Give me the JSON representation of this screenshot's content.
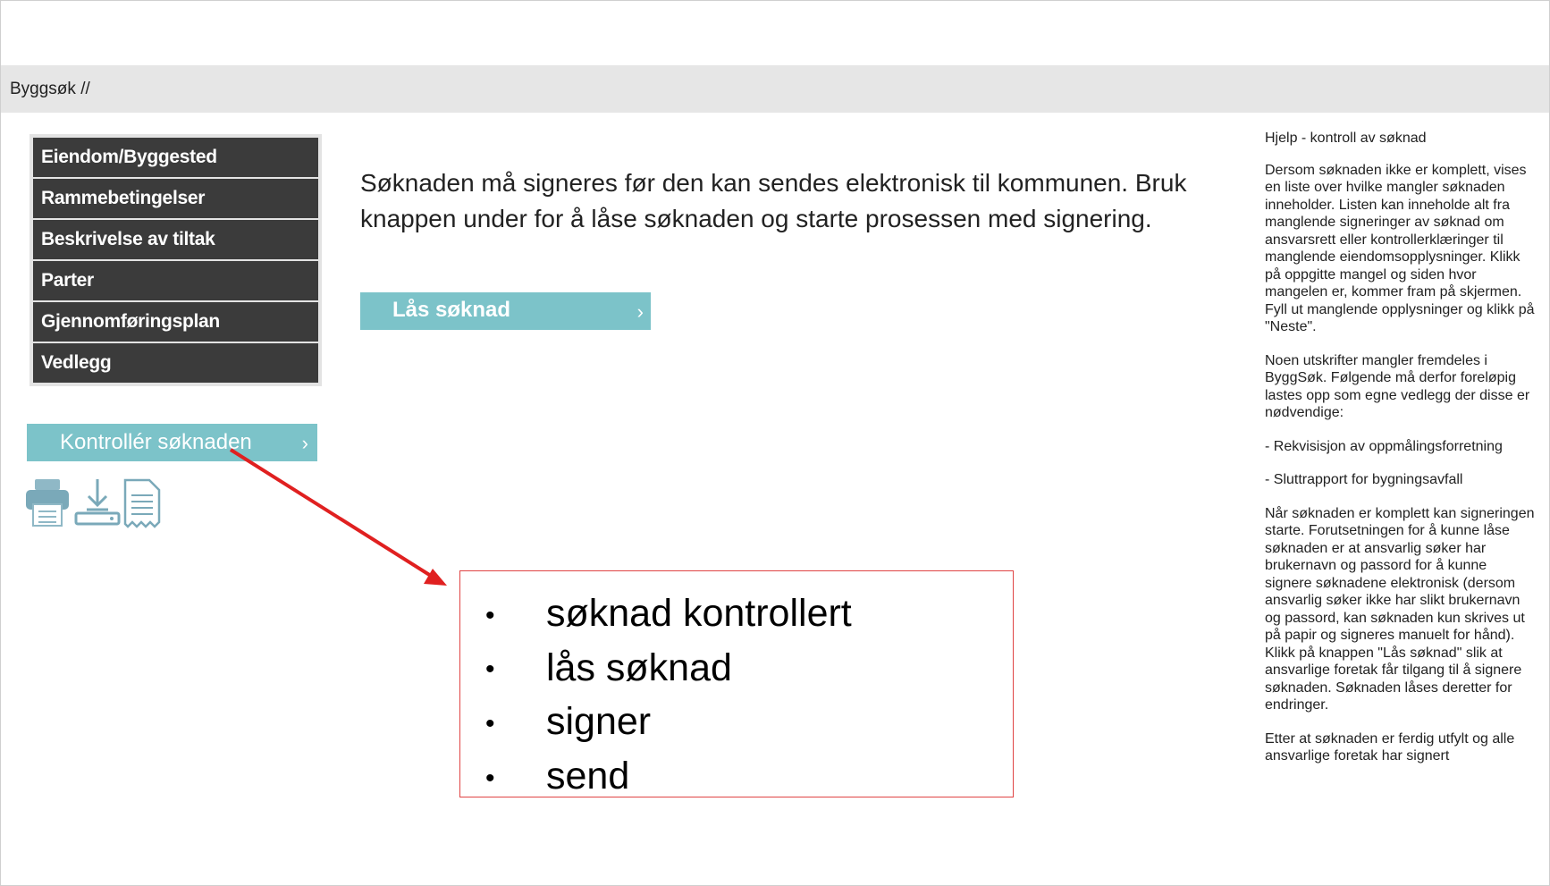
{
  "breadcrumb": "Byggsøk //",
  "nav": {
    "items": [
      {
        "label": "Eiendom/Byggested"
      },
      {
        "label": "Rammebetingelser"
      },
      {
        "label": "Beskrivelse av tiltak"
      },
      {
        "label": "Parter"
      },
      {
        "label": "Gjennomføringsplan"
      },
      {
        "label": "Vedlegg"
      }
    ]
  },
  "check_button": {
    "label": "Kontrollér søknaden",
    "chevron": "›"
  },
  "tools": {
    "icons": [
      "print-icon",
      "download-icon",
      "document-icon"
    ]
  },
  "main": {
    "message": "Søknaden må signeres før den kan sendes elektronisk til kommunen. Bruk knappen under for å låse søknaden og starte prosessen med signering.",
    "lock_button": {
      "label": "Lås søknad",
      "chevron": "›"
    }
  },
  "help": {
    "title": "Hjelp - kontroll av søknad",
    "paragraphs": [
      "Dersom søknaden ikke er komplett, vises en liste over hvilke mangler søknaden inneholder. Listen kan inneholde alt fra manglende signeringer av søknad om ansvarsrett eller kontrollerklæringer til manglende eiendomsopplysninger. Klikk på oppgitte mangel og siden hvor mangelen er, kommer fram på skjermen. Fyll ut manglende opplysninger og klikk på \"Neste\".",
      "Noen utskrifter mangler fremdeles i ByggSøk. Følgende må derfor foreløpig lastes opp som egne vedlegg der disse er nødvendige:",
      "- Rekvisisjon av oppmålingsforretning",
      "- Sluttrapport for bygningsavfall",
      "Når søknaden er komplett kan signeringen starte. Forutsetningen for å kunne låse søknaden er at ansvarlig søker har brukernavn og passord for å kunne signere søknadene elektronisk (dersom ansvarlig søker ikke har slikt brukernavn og passord, kan søknaden kun skrives ut på papir og signeres manuelt for hånd). Klikk på knappen \"Lås søknad\" slik at ansvarlige foretak får tilgang til å signere søknaden. Søknaden låses deretter for endringer.",
      "Etter at søknaden er ferdig utfylt og alle ansvarlige foretak har signert"
    ]
  },
  "annotation": {
    "bullet": "•",
    "items": [
      "søknad kontrollert",
      "lås søknad",
      "signer",
      "send"
    ],
    "arrow_color": "#e02020",
    "border_color": "#e04444"
  },
  "colors": {
    "teal": "#7cc3c9",
    "nav_bg": "#3b3b3b",
    "topbar": "#e6e6e6"
  }
}
